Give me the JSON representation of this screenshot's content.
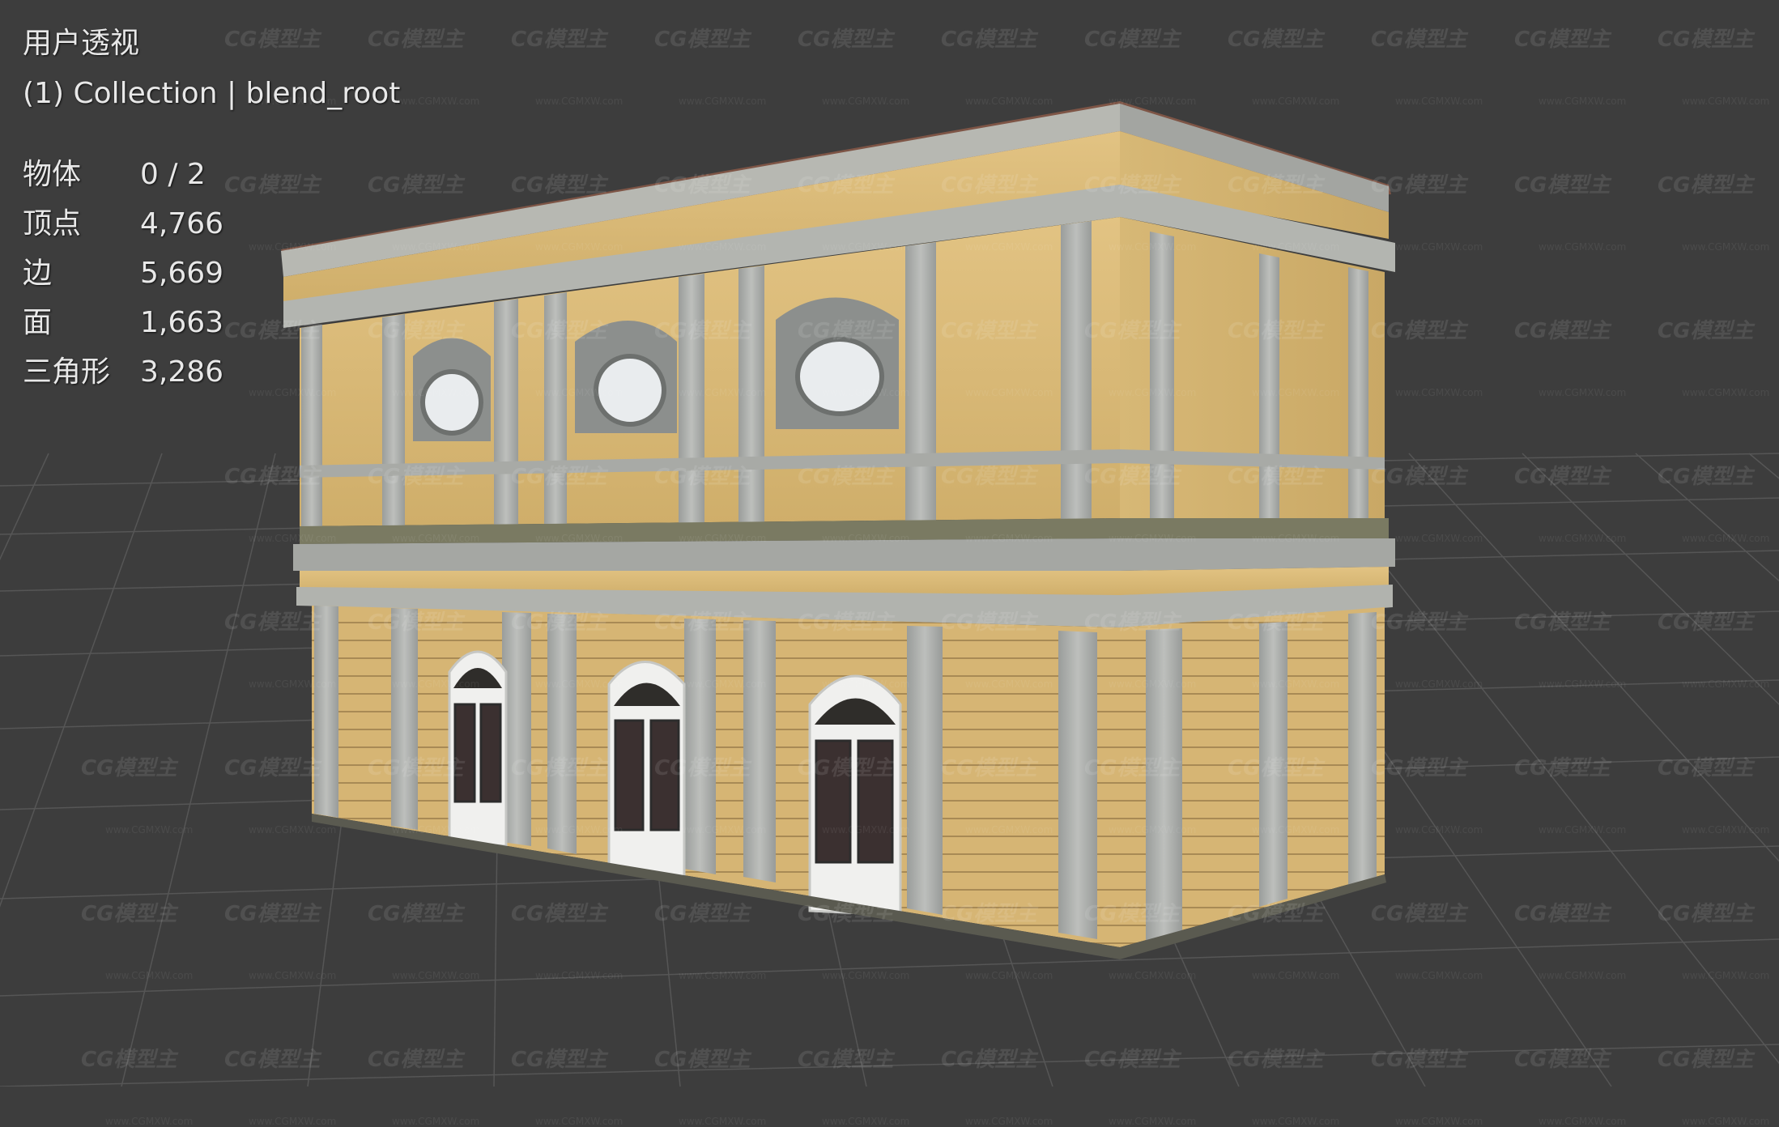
{
  "viewport": {
    "view_name": "用户透视",
    "collection_line": "(1) Collection | blend_root",
    "stats": [
      {
        "label": "物体",
        "value": "0 / 2"
      },
      {
        "label": "顶点",
        "value": "4,766"
      },
      {
        "label": "边",
        "value": "5,669"
      },
      {
        "label": "面",
        "value": "1,663"
      },
      {
        "label": "三角形",
        "value": "3,286"
      }
    ]
  },
  "watermark": {
    "logo_text": "CG模型主",
    "url_text": "www.CGMXW.com"
  },
  "colors": {
    "background": "#3d3d3d",
    "grid_line": "#5a5a5a",
    "facade_yellow": "#d9b872",
    "stone_gray": "#a9aba7",
    "roof_red": "#8a5a4a"
  },
  "model": {
    "subject": "3d-building-model"
  }
}
